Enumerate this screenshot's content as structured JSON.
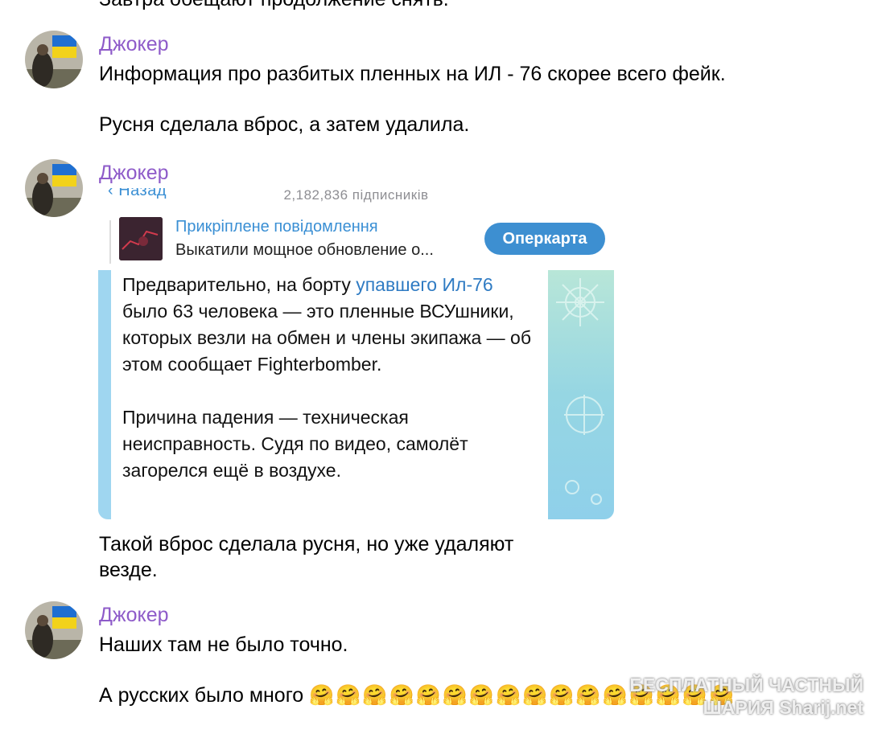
{
  "previous_message": {
    "text": "Завтра обещают продолжение снять."
  },
  "messages": [
    {
      "author": "Джокер",
      "lines": [
        "Информация про разбитых пленных на ИЛ - 76 скорее всего фейк.",
        "Русня сделала вброс, а затем удалила."
      ]
    },
    {
      "author": "Джокер",
      "embed": {
        "back_label": "Назад",
        "subscribers": "2,182,836 підписників",
        "pinned_title": "Прикріплене повідомлення",
        "pinned_text": "Выкатили мощное обновление о...",
        "button_label": "Оперкарта",
        "post_p1_a": "Предварительно, на борту ",
        "post_p1_link": "упавшего Ил-76",
        "post_p1_b": " было 63 человека — это пленные ВСУшники, которых везли на обмен и члены экипажа — об этом сообщает Fighterbomber.",
        "post_p2": "Причина падения — техническая неисправность. Судя по видео, самолёт загорелся ещё в воздухе."
      },
      "caption_line1": "Такой вброс сделала русня, но уже удаляют",
      "caption_line2": "везде."
    },
    {
      "author": "Джокер",
      "line1": "Наших там не было точно.",
      "line2": "А русских было много",
      "emoji": "🤗🤗🤗🤗🤗🤗🤗🤗🤗🤗🤗🤗🤗🤗🤗🤗"
    }
  ],
  "watermark": {
    "line1": "БЕСПЛАТНЫЙ ЧАСТНЫЙ",
    "line2": "ШАРИЯ   Sharij.net"
  },
  "colors": {
    "author": "#8e5bc9",
    "link": "#2f7bc3",
    "button": "#3d8fd1"
  }
}
